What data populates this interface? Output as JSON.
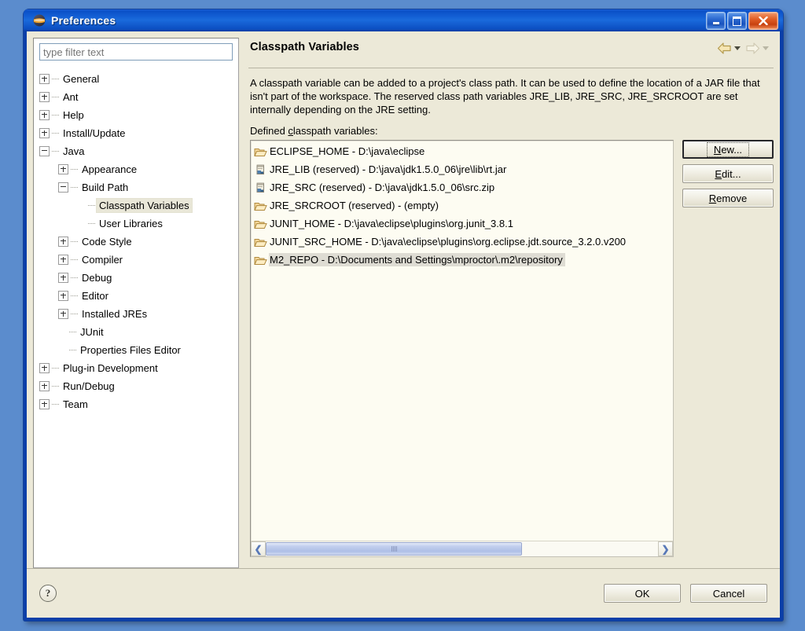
{
  "window": {
    "title": "Preferences",
    "icon": "eclipse-globe-icon",
    "controls": {
      "minimize": "minimize-icon",
      "maximize": "maximize-icon",
      "close": "close-icon"
    }
  },
  "colors": {
    "dialog_bg": "#ECE9D8",
    "titlebar_blue": "#0A50C8",
    "frame_blue": "#0B3FA8",
    "list_bg": "#FDFCF2",
    "tree_selection": "#E9E7D8",
    "list_selection": "#DEDCD3",
    "scrollbar_thumb": "#AEBFE7",
    "close_button": "#E25F27"
  },
  "filter": {
    "placeholder": "type filter text",
    "value": ""
  },
  "tree": {
    "items": [
      {
        "label": "General",
        "level": 1,
        "expander": "plus"
      },
      {
        "label": "Ant",
        "level": 1,
        "expander": "plus"
      },
      {
        "label": "Help",
        "level": 1,
        "expander": "plus"
      },
      {
        "label": "Install/Update",
        "level": 1,
        "expander": "plus"
      },
      {
        "label": "Java",
        "level": 1,
        "expander": "minus"
      },
      {
        "label": "Appearance",
        "level": 2,
        "expander": "plus"
      },
      {
        "label": "Build Path",
        "level": 2,
        "expander": "minus"
      },
      {
        "label": "Classpath Variables",
        "level": 3,
        "expander": "none",
        "selected": true
      },
      {
        "label": "User Libraries",
        "level": 3,
        "expander": "none"
      },
      {
        "label": "Code Style",
        "level": 2,
        "expander": "plus"
      },
      {
        "label": "Compiler",
        "level": 2,
        "expander": "plus"
      },
      {
        "label": "Debug",
        "level": 2,
        "expander": "plus"
      },
      {
        "label": "Editor",
        "level": 2,
        "expander": "plus"
      },
      {
        "label": "Installed JREs",
        "level": 2,
        "expander": "plus"
      },
      {
        "label": "JUnit",
        "level": 2,
        "expander": "none"
      },
      {
        "label": "Properties Files Editor",
        "level": 2,
        "expander": "none"
      },
      {
        "label": "Plug-in Development",
        "level": 1,
        "expander": "plus"
      },
      {
        "label": "Run/Debug",
        "level": 1,
        "expander": "plus"
      },
      {
        "label": "Team",
        "level": 1,
        "expander": "plus"
      }
    ]
  },
  "page": {
    "title": "Classpath Variables",
    "nav": {
      "back": "back-arrow-icon",
      "back_dropdown": "chevron-down-icon",
      "forward": "forward-arrow-icon",
      "forward_dropdown": "chevron-down-icon"
    },
    "description": "A classpath variable can be added to a project's class path. It can be used to define the location of a JAR file that isn't part of the workspace. The reserved class path variables JRE_LIB, JRE_SRC, JRE_SRCROOT are set internally depending on the JRE setting.",
    "list_label_prefix": "Defined ",
    "list_label_mnemonic": "c",
    "list_label_suffix": "lasspath variables:",
    "variables": [
      {
        "name": "ECLIPSE_HOME",
        "text": "ECLIPSE_HOME - D:\\java\\eclipse",
        "icon": "folder-icon"
      },
      {
        "name": "JRE_LIB",
        "text": "JRE_LIB (reserved) - D:\\java\\jdk1.5.0_06\\jre\\lib\\rt.jar",
        "icon": "jar-icon"
      },
      {
        "name": "JRE_SRC",
        "text": "JRE_SRC (reserved) - D:\\java\\jdk1.5.0_06\\src.zip",
        "icon": "jar-icon"
      },
      {
        "name": "JRE_SRCROOT",
        "text": "JRE_SRCROOT (reserved) - (empty)",
        "icon": "folder-icon"
      },
      {
        "name": "JUNIT_HOME",
        "text": "JUNIT_HOME - D:\\java\\eclipse\\plugins\\org.junit_3.8.1",
        "icon": "folder-icon"
      },
      {
        "name": "JUNIT_SRC_HOME",
        "text": "JUNIT_SRC_HOME - D:\\java\\eclipse\\plugins\\org.eclipse.jdt.source_3.2.0.v200",
        "icon": "folder-icon"
      },
      {
        "name": "M2_REPO",
        "text": "M2_REPO - D:\\Documents and Settings\\mproctor\\.m2\\repository",
        "icon": "folder-icon",
        "selected": true
      }
    ],
    "scrollbar": {
      "thumb_percent": 65,
      "left_arrow": "chevron-left-icon",
      "right_arrow": "chevron-right-icon"
    },
    "buttons": [
      {
        "name": "new-button",
        "mnemonic": "N",
        "before": "",
        "after": "ew...",
        "focused": true
      },
      {
        "name": "edit-button",
        "mnemonic": "E",
        "before": "",
        "after": "dit..."
      },
      {
        "name": "remove-button",
        "mnemonic": "R",
        "before": "",
        "after": "emove"
      }
    ]
  },
  "footer": {
    "help": "?",
    "ok": "OK",
    "cancel": "Cancel"
  }
}
